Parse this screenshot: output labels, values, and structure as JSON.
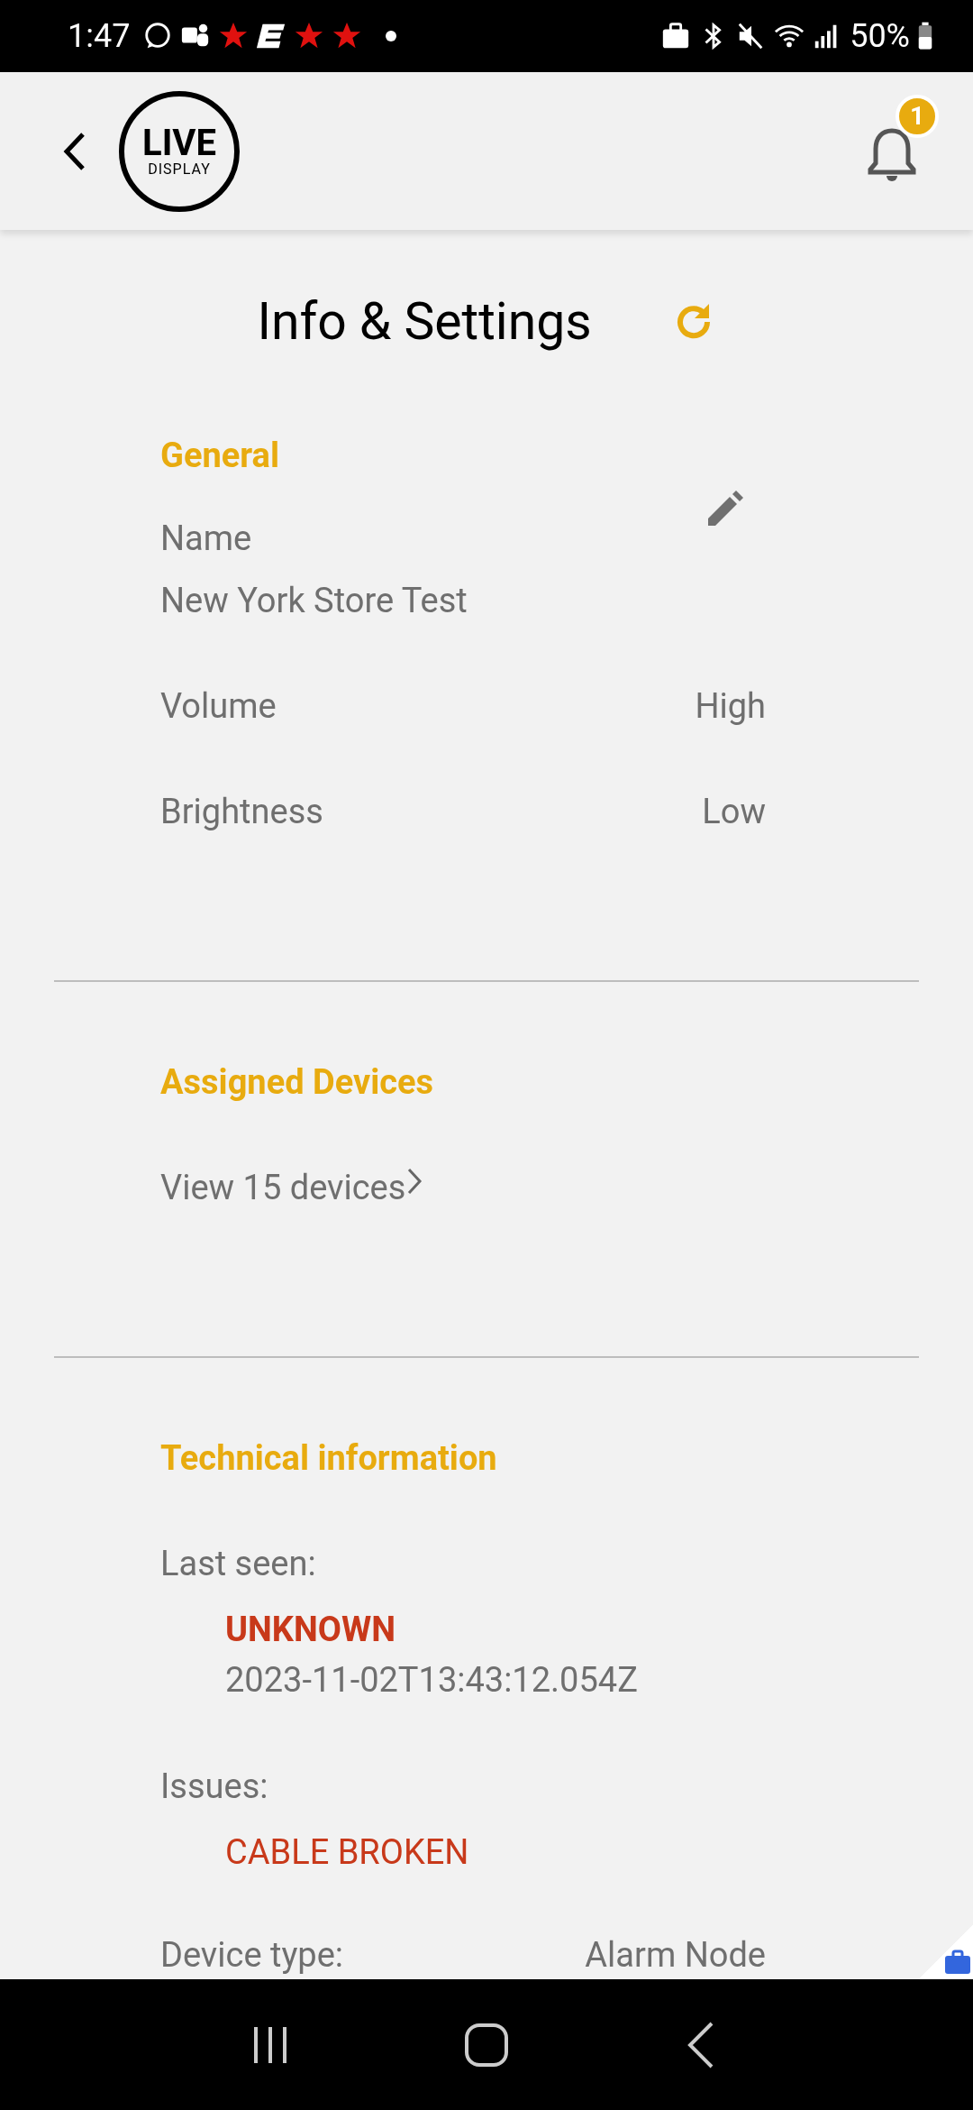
{
  "status_bar": {
    "time": "1:47",
    "battery": "50%"
  },
  "header": {
    "logo_top": "LIVE",
    "logo_bottom": "DISPLAY",
    "notification_count": "1"
  },
  "title": "Info & Settings",
  "sections": [
    {
      "heading": "General",
      "fields": [
        {
          "kind": "editable",
          "label": "Name",
          "value": "New York Store Test"
        },
        {
          "kind": "pair",
          "label": "Volume",
          "value": "High"
        },
        {
          "kind": "pair",
          "label": "Brightness",
          "value": "Low"
        }
      ]
    },
    {
      "heading": "Assigned Devices",
      "link": "View 15 devices"
    },
    {
      "heading": "Technical information",
      "fields": [
        {
          "kind": "stack",
          "label": "Last seen:",
          "status": "UNKNOWN",
          "bold": true,
          "value": "2023-11-02T13:43:12.054Z"
        },
        {
          "kind": "stack",
          "label": "Issues:",
          "status": "CABLE BROKEN",
          "bold": false
        },
        {
          "kind": "pair",
          "label": "Device type:",
          "value": "Alarm Node"
        }
      ]
    }
  ]
}
